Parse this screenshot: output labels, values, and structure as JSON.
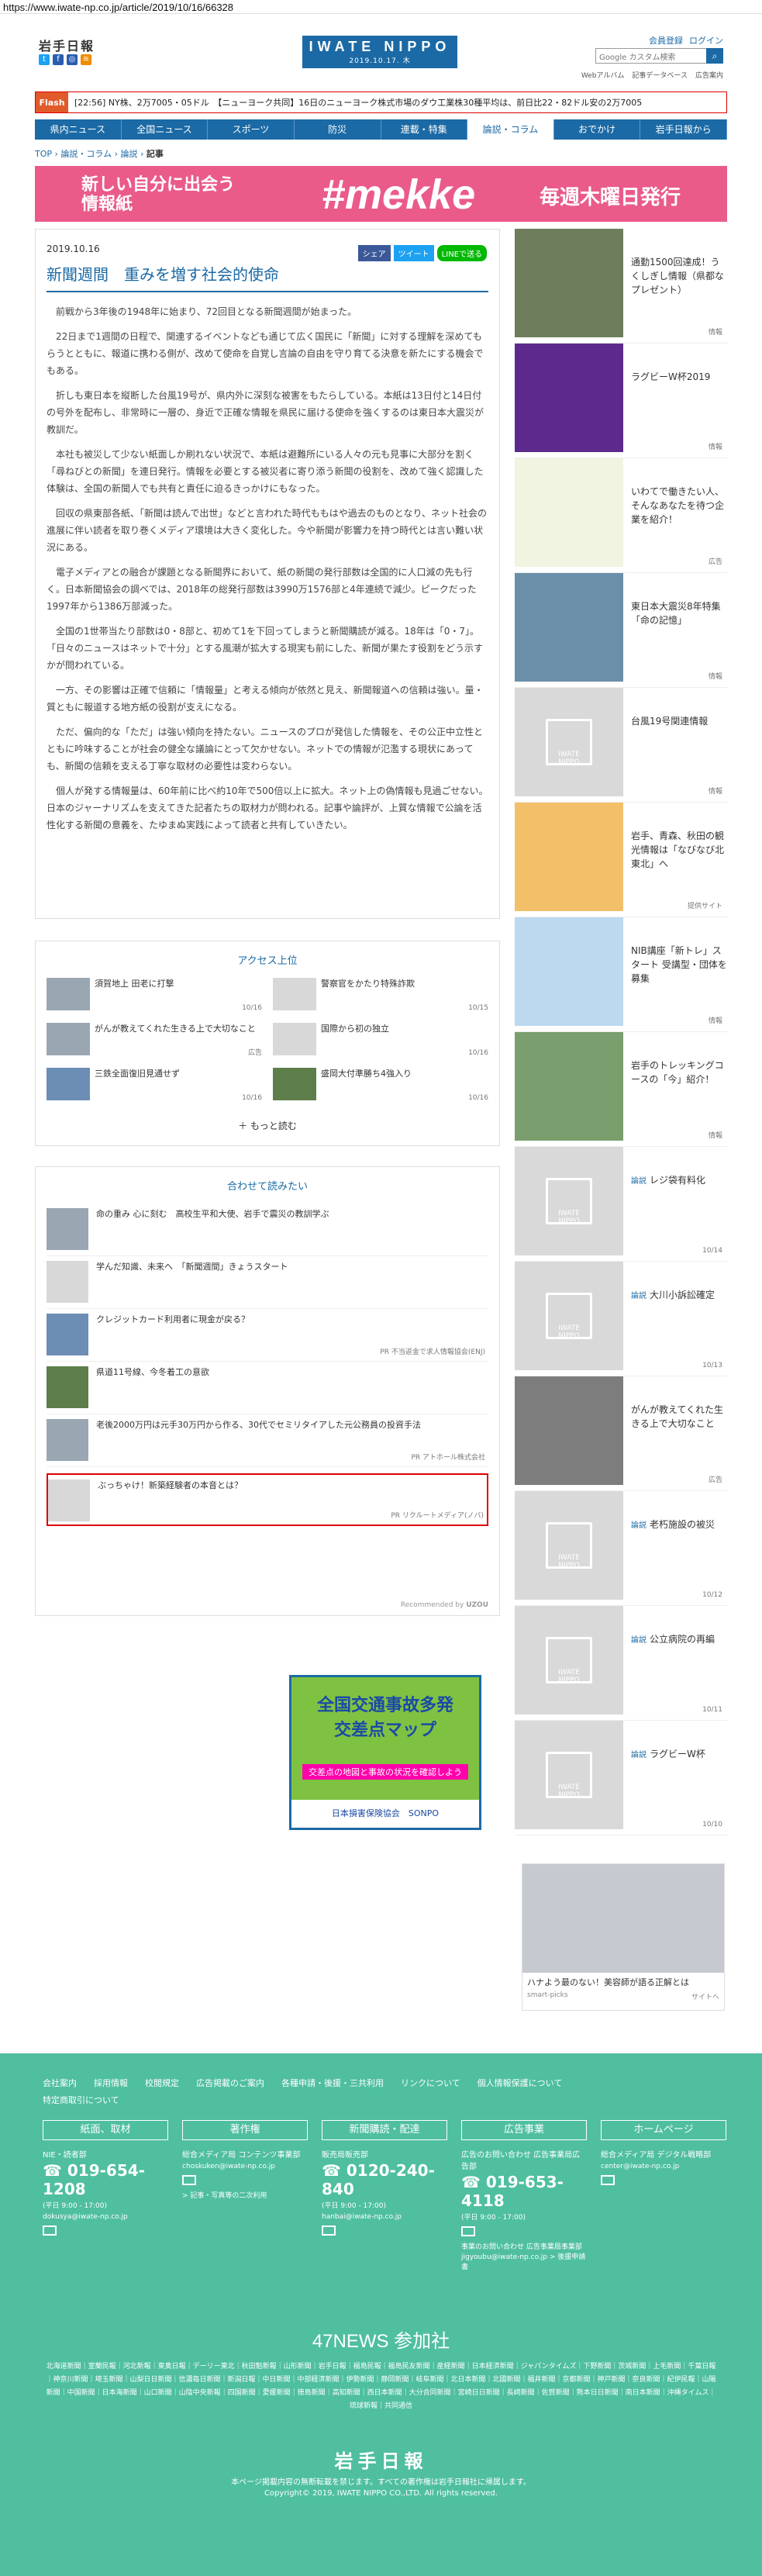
{
  "url": "https://www.iwate-np.co.jp/article/2019/10/16/66328",
  "header": {
    "logo_small": "岩手日報",
    "center_logo": "IWATE NIPPO",
    "center_date": "2019.10.17. 木",
    "top_links": [
      "会員登録",
      "ログイン"
    ],
    "sub_links": [
      "Webアルバム",
      "記事データベース",
      "広告案内"
    ],
    "search_placeholder": "Google カスタム検索",
    "social_icons": [
      "twitter-icon",
      "facebook-icon",
      "instagram-icon",
      "rss-icon"
    ]
  },
  "flash": {
    "tag": "Flash",
    "text": "[22:56] NY株、2万7005・05ドル　【ニューヨーク共同】16日のニューヨーク株式市場のダウ工業株30種平均は、前日比22・82ドル安の2万7005"
  },
  "nav": [
    "県内ニュース",
    "全国ニュース",
    "スポーツ",
    "防災",
    "連載・特集",
    "論説・コラム",
    "おでかけ",
    "岩手日報から"
  ],
  "nav_active": 5,
  "breadcrumb": {
    "items": [
      "TOP",
      "論説・コラム",
      "論説"
    ],
    "current": "記事"
  },
  "banner": {
    "left": "新しい自分に出会う\n情報紙",
    "brand": "#mekke",
    "ruby": "めっけ",
    "right": "毎週木曜日発行"
  },
  "article": {
    "date": "2019.10.16",
    "title": "新聞週間　重みを増す社会的使命",
    "share": [
      "シェア",
      "ツイート",
      "LINEで送る"
    ],
    "paragraphs": [
      "前戦から3年後の1948年に始まり、72回目となる新聞週間が始まった。",
      "22日まで1週間の日程で、関連するイベントなども通じて広く国民に「新聞」に対する理解を深めてもらうとともに、報道に携わる側が、改めて使命を自覚し言論の自由を守り育てる決意を新たにする機会でもある。",
      "折しも東日本を縦断した台風19号が、県内外に深刻な被害をもたらしている。本紙は13日付と14日付の号外を配布し、非常時に一層の、身近で正確な情報を県民に届ける使命を強くするのは東日本大震災が教訓だ。",
      "本社も被災して少ない紙面しか刷れない状況で、本紙は避難所にいる人々の元も見事に大部分を割く「尋ねびとの新聞」を連日発行。情報を必要とする被災者に寄り添う新聞の役割を、改めて強く認識した体験は、全国の新聞人でも共有と責任に迫るきっかけにもなった。",
      "回収の県東部各紙、「新聞は読んで出世」などと言われた時代ももはや過去のものとなり、ネット社会の進展に伴い読者を取り巻くメディア環境は大きく変化した。今や新聞が影響力を持つ時代とは言い難い状況にある。",
      "電子メディアとの融合が課題となる新聞界において、紙の新聞の発行部数は全国的に人口減の先も行く。日本新聞協会の調べでは、2018年の総発行部数は3990万1576部と4年連続で減少。ピークだった1997年から1386万部減った。",
      "全国の1世帯当たり部数は0・8部と、初めて1を下回ってしまうと新聞購読が減る。18年は「0・7」。「日々のニュースはネットで十分」とする風潮が拡大する現実も前にした、新聞が果たす役割をどう示すかが問われている。",
      "一方、その影響は正確で信頼に「情報量」と考える傾向が依然と見え、新聞報道への信頼は強い。量・質ともに報道する地方紙の役割が支えになる。",
      "ただ、偏向的な「ただ」は強い傾向を持たない。ニュースのプロが発信した情報を、その公正中立性とともに吟味することが社会の健全な議論にとって欠かせない。ネットでの情報が氾濫する現状にあっても、新聞の信頼を支える丁寧な取材の必要性は変わらない。",
      "個人が発する情報量は、60年前に比べ約10年で500倍以上に拡大。ネット上の偽情報も見過ごせない。日本のジャーナリズムを支えてきた記者たちの取材力が問われる。記事や論評が、上質な情報で公論を活性化する新聞の意義を、たゆまぬ実践によって読者と共有していきたい。"
    ]
  },
  "ranking": {
    "title": "アクセス上位",
    "items": [
      {
        "title": "須賀地上 田老に打撃",
        "date": "10/16"
      },
      {
        "title": "警察官をかたり特殊詐欺",
        "date": "10/15"
      },
      {
        "title": "がんが教えてくれた生きる上で大切なこと",
        "date": "広告",
        "ad": true
      },
      {
        "title": "国際から初の独立",
        "date": "10/16"
      },
      {
        "title": "三鉄全面復旧見通せず",
        "date": "10/16"
      },
      {
        "title": "盛岡大付準勝ち4強入り",
        "date": "10/16"
      }
    ],
    "more": "もっと読む"
  },
  "related": {
    "title": "合わせて読みたい",
    "items": [
      {
        "title": "命の重み 心に刻む　高校生平和大使、岩手で震災の教訓学ぶ",
        "src": ""
      },
      {
        "title": "学んだ知識、未来へ　「新聞週間」きょうスタート",
        "src": ""
      },
      {
        "title": "クレジットカード利用者に現金が戻る？",
        "src": "PR 不当返金で求人情報協会(ENJ)"
      },
      {
        "title": "県道11号線、今冬着工の意欲",
        "src": ""
      },
      {
        "title": "老後2000万円は元手30万円から作る、30代でセミリタイアした元公務員の投資手法",
        "src": "PR アトホール株式会社"
      },
      {
        "title": "ぶっちゃけ！新築経験者の本音とは？",
        "src": "PR リクルートメディア(ノバ)",
        "highlight": true
      }
    ],
    "rec_by": "Recommended by",
    "rec_brand": "UZOU"
  },
  "ad_bottom": {
    "line1": "全国交通事故多発",
    "line2": "交差点マップ",
    "line3": "交差点の地図と事故の状況を確認しよう",
    "sponsor": "日本損害保険協会　SONPO"
  },
  "sidebar": [
    {
      "kind": "",
      "title": "通勤1500回達成！うくしぎし情報（県都なプレゼント）",
      "meta": "情報",
      "img": "person"
    },
    {
      "kind": "",
      "title": "ラグビーW杯2019",
      "meta": "情報",
      "img": "rugby"
    },
    {
      "kind": "",
      "title": "いわてで働きたい人、そんなあなたを待つ企業を紹介！",
      "meta": "広告",
      "img": "work"
    },
    {
      "kind": "",
      "title": "東日本大震災8年特集「命の記憶」",
      "meta": "情報",
      "img": "quake"
    },
    {
      "kind": "",
      "title": "台風19号関連情報",
      "meta": "情報",
      "img": "ph"
    },
    {
      "kind": "",
      "title": "岩手、青森、秋田の観光情報は「なびなび北東北」へ",
      "meta": "提供サイト",
      "img": "navi"
    },
    {
      "kind": "",
      "title": "NIB講座「新トレ」スタート 受講型・団体を募集",
      "meta": "情報",
      "img": "nib"
    },
    {
      "kind": "",
      "title": "岩手のトレッキングコースの「今」紹介！",
      "meta": "情報",
      "img": "mountain"
    },
    {
      "kind": "論説",
      "title": "レジ袋有料化",
      "meta": "10/14",
      "img": "ph"
    },
    {
      "kind": "論説",
      "title": "大川小訴訟確定",
      "meta": "10/13",
      "img": "ph"
    },
    {
      "kind": "",
      "title": "がんが教えてくれた生きる上で大切なこと",
      "meta": "広告",
      "img": "man"
    },
    {
      "kind": "論説",
      "title": "老朽施設の被災",
      "meta": "10/12",
      "img": "ph"
    },
    {
      "kind": "論説",
      "title": "公立病院の再編",
      "meta": "10/11",
      "img": "ph"
    },
    {
      "kind": "論説",
      "title": "ラグビーW杯",
      "meta": "10/10",
      "img": "ph"
    }
  ],
  "side_ad": {
    "caption": "ハナよう最のない！美容師が語る正解とは",
    "src": "smart-picks",
    "src_right": "サイトへ"
  },
  "footer": {
    "links": [
      "会社案内",
      "採用情報",
      "校閲規定",
      "広告掲載のご案内",
      "各種申請・後援・三共利用",
      "リンクについて",
      "個人情報保護について",
      "特定商取引について"
    ],
    "cols": [
      {
        "head": "紙面、取材",
        "label": "NIE・読者部",
        "tel": "019-654-1208",
        "hours": "(平日 9:00 - 17:00)",
        "mail": "dokusya@iwate-np.co.jp",
        "extra": ""
      },
      {
        "head": "著作権",
        "label": "総合メディア局 コンテンツ事業部",
        "tel": "",
        "hours": "",
        "mail": "choskuken@iwate-np.co.jp",
        "extra": "> 記事・写真等の二次利用"
      },
      {
        "head": "新聞購読・配達",
        "label": "販売局販売部",
        "tel": "0120-240-840",
        "hours": "(平日 9:00 - 17:00)",
        "mail": "hanbai@iwate-np.co.jp",
        "extra": ""
      },
      {
        "head": "広告事業",
        "label": "広告のお問い合わせ 広告事業局広告部",
        "tel": "019-653-4118",
        "hours": "(平日 9:00 - 17:00)",
        "mail": "",
        "extra": "事業のお問い合わせ 広告事業局事業部 jigyoubu@iwate-np.co.jp > 後援申請書"
      },
      {
        "head": "ホームページ",
        "label": "総合メディア局 デジタル戦略部",
        "tel": "",
        "hours": "",
        "mail": "center@iwate-np.co.jp",
        "extra": ""
      }
    ],
    "title47": "47NEWS 参加社",
    "papers": "北海道新聞｜室蘭民報｜河北新報｜東奥日報｜デーリー東北｜秋田魁新報｜山形新聞｜岩手日報｜福島民報｜福島民友新聞｜産経新聞｜日本経済新聞｜ジャパンタイムズ｜下野新聞｜茨城新聞｜上毛新聞｜千葉日報｜神奈川新聞｜埼玉新聞｜山梨日日新聞｜信濃毎日新聞｜新潟日報｜中日新聞｜中部経済新聞｜伊勢新聞｜静岡新聞｜岐阜新聞｜北日本新聞｜北國新聞｜福井新聞｜京都新聞｜神戸新聞｜奈良新聞｜紀伊民報｜山陽新聞｜中国新聞｜日本海新聞｜山口新聞｜山陰中央新報｜四国新聞｜愛媛新聞｜徳島新聞｜高知新聞｜西日本新聞｜大分合同新聞｜宮崎日日新聞｜長崎新聞｜佐賀新聞｜熊本日日新聞｜南日本新聞｜沖縄タイムス｜琉球新報｜共同通信",
    "logo": "岩手日報",
    "notice": "本ページ掲載内容の無断転載を禁じます。すべての著作権は岩手日報社に帰属します。",
    "copyright": "Copyright© 2019, IWATE NIPPO CO.,LTD. All rights reserved."
  }
}
